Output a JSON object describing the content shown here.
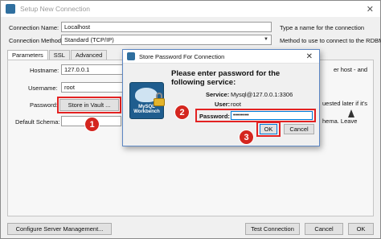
{
  "window": {
    "title": "Setup New Connection"
  },
  "form": {
    "connection_name_label": "Connection Name:",
    "connection_name_value": "Localhost",
    "connection_name_hint": "Type a name for the connection",
    "connection_method_label": "Connection Method:",
    "connection_method_value": "Standard (TCP/IP)",
    "connection_method_hint": "Method to use to connect to the RDBMS"
  },
  "tabs": [
    {
      "label": "Parameters"
    },
    {
      "label": "SSL"
    },
    {
      "label": "Advanced"
    }
  ],
  "parameters": {
    "hostname_label": "Hostname:",
    "hostname_value": "127.0.0.1",
    "hostname_hint_partial": "er host - and",
    "username_label": "Username:",
    "username_value": "root",
    "password_label": "Password:",
    "store_vault_button": "Store in Vault ...",
    "password_hint_partial": "uested later if it's",
    "default_schema_label": "Default Schema:",
    "default_schema_hint_partial": "hema. Leave"
  },
  "footer": {
    "configure_button": "Configure Server Management...",
    "test_button": "Test Connection",
    "cancel_button": "Cancel",
    "ok_button": "OK"
  },
  "dialog": {
    "title": "Store Password For Connection",
    "heading_line1": "Please enter password for the",
    "heading_line2": "following service:",
    "service_label": "Service:",
    "service_value": "Mysql@127.0.0.1:3306",
    "user_label": "User:",
    "user_value": "root",
    "password_label": "Password:",
    "password_value": "••••••••",
    "ok_button": "OK",
    "cancel_button": "Cancel",
    "logo_text_1": "MySQL",
    "logo_text_2": "Workbench"
  },
  "annotations": {
    "step1": "1",
    "step2": "2",
    "step3": "3",
    "color": "#d4261f"
  }
}
